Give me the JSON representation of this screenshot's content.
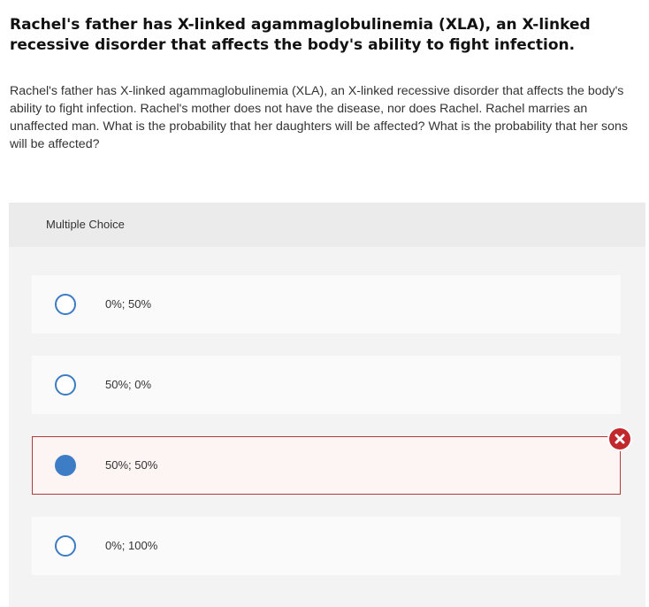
{
  "question": {
    "title": "Rachel's father has X-linked agammaglobulinemia (XLA), an X-linked recessive disorder that affects the body's ability to fight infection.",
    "body": "Rachel's father has X-linked agammaglobulinemia (XLA), an X-linked recessive disorder that affects the body's ability to fight infection. Rachel's mother does not have the disease, nor does Rachel. Rachel marries an unaffected man. What is the probability that her daughters will be affected? What is the probability that her sons will be affected?"
  },
  "multiple_choice": {
    "label": "Multiple Choice",
    "options": [
      {
        "label": "0%; 50%",
        "selected": false
      },
      {
        "label": "50%; 0%",
        "selected": false
      },
      {
        "label": "50%; 50%",
        "selected": true,
        "status": "incorrect"
      },
      {
        "label": "0%; 100%",
        "selected": false
      }
    ]
  },
  "colors": {
    "accent_blue": "#3d7dc6",
    "incorrect_red": "#c0282d",
    "incorrect_border": "#b03a3a",
    "incorrect_bg": "#fdf4f4"
  },
  "icons": {
    "radio_unselected": "radio-empty-icon",
    "radio_selected": "radio-filled-icon",
    "incorrect_marker": "x-circle-icon"
  }
}
